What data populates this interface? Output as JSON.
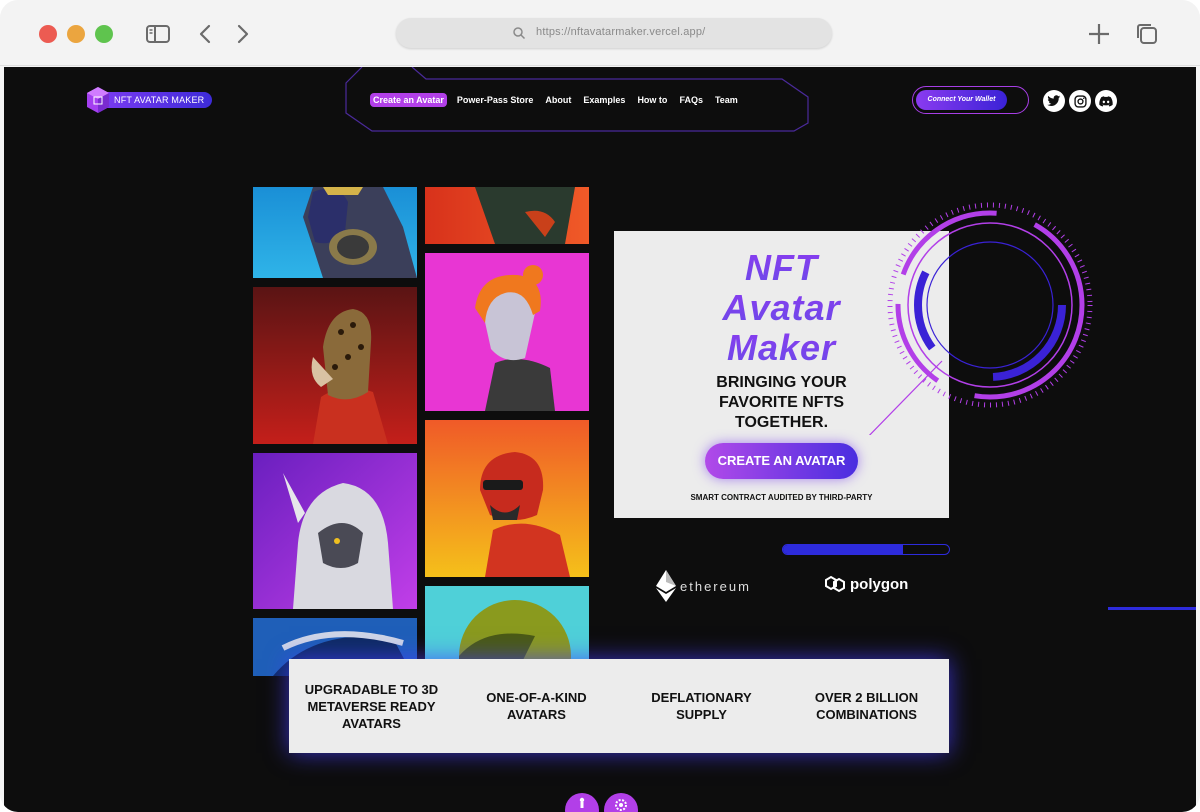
{
  "browser": {
    "url": "https://nftavatarmaker.vercel.app/",
    "icons": [
      "sidebar-icon",
      "back-icon",
      "forward-icon",
      "search-icon",
      "new-tab-icon",
      "tabs-icon"
    ]
  },
  "header": {
    "logo_text": "NFT AVATAR MAKER",
    "nav": [
      "Create an Avatar",
      "Power-Pass Store",
      "About",
      "Examples",
      "How to",
      "FAQs",
      "Team"
    ],
    "wallet_label": "Connect Your Wallet",
    "social": [
      "twitter-icon",
      "instagram-icon",
      "discord-icon"
    ]
  },
  "hero": {
    "title_line1": "NFT",
    "title_line2": "Avatar",
    "title_line3": "Maker",
    "tagline_line1": "BRINGING YOUR",
    "tagline_line2": "FAVORITE NFTS",
    "tagline_line3": "TOGETHER.",
    "cta": "CREATE AN AVATAR",
    "audit": "SMART CONTRACT AUDITED BY THIRD-PARTY"
  },
  "progress": {
    "fill_fraction": 0.72
  },
  "chains": {
    "ethereum": "ethereum",
    "polygon": "polygon"
  },
  "features": [
    {
      "line1": "UPGRADABLE TO 3D",
      "line2": "METAVERSE READY",
      "line3": "AVATARS"
    },
    {
      "line1": "ONE-OF-A-KIND",
      "line2": "AVATARS"
    },
    {
      "line1": "DEFLATIONARY",
      "line2": "SUPPLY"
    },
    {
      "line1": "OVER 2 BILLION",
      "line2": "COMBINATIONS"
    }
  ],
  "colors": {
    "accent_purple": "#b23fe8",
    "accent_blue": "#2d2bdc",
    "page_bg": "#0d0d0d"
  }
}
